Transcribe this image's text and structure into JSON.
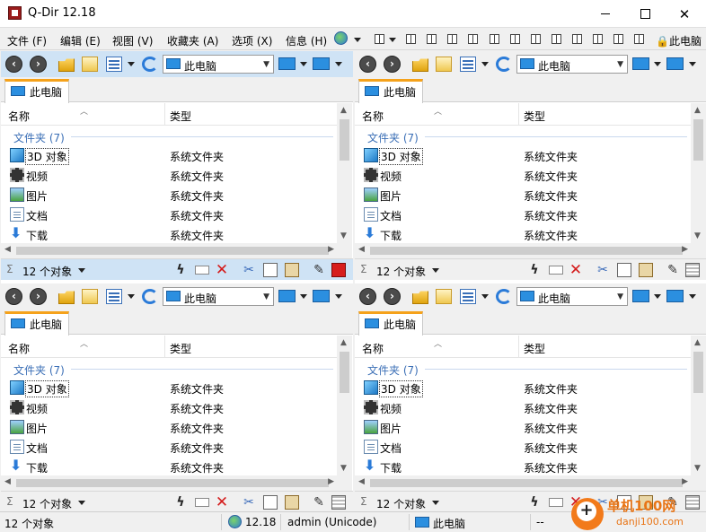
{
  "window": {
    "title": "Q-Dir 12.18"
  },
  "menu": {
    "items": [
      "文件 (F)",
      "编辑 (E)",
      "视图 (V)",
      "收藏夹 (A)",
      "选项 (X)",
      "信息 (H)"
    ],
    "tail_label": "此电脑"
  },
  "pane": {
    "address": "此电脑",
    "tab_label": "此电脑",
    "columns": {
      "name": "名称",
      "type": "类型"
    },
    "group_label": "文件夹 (7)",
    "rows": [
      {
        "name": "3D 对象",
        "type": "系统文件夹",
        "icon": "3d-objects-icon"
      },
      {
        "name": "视频",
        "type": "系统文件夹",
        "icon": "video-icon"
      },
      {
        "name": "图片",
        "type": "系统文件夹",
        "icon": "pictures-icon"
      },
      {
        "name": "文档",
        "type": "系统文件夹",
        "icon": "documents-icon"
      },
      {
        "name": "下载",
        "type": "系统文件夹",
        "icon": "download-icon"
      }
    ],
    "status_count": "12 个对象"
  },
  "statusbar": {
    "count": "12 个对象",
    "version": "12.18",
    "user": "admin (Unicode)",
    "location": "此电脑",
    "extra": "--"
  },
  "watermark": {
    "title": "单机100网",
    "url": "danji100.com"
  },
  "colors": {
    "active_pane": "#cfe3f5",
    "tab_accent": "#f5a21b",
    "group_text": "#3b6fb6"
  }
}
